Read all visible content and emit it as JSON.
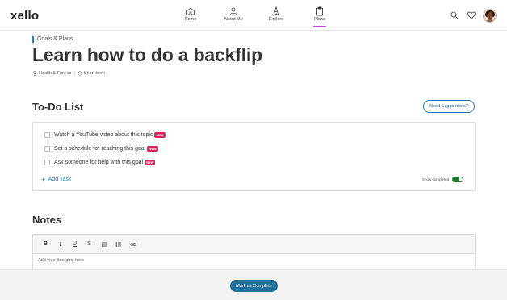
{
  "app": {
    "logo": "xello"
  },
  "nav": {
    "items": [
      {
        "label": "Home",
        "icon": "home-icon"
      },
      {
        "label": "About Me",
        "icon": "person-icon"
      },
      {
        "label": "Explore",
        "icon": "compass-icon"
      },
      {
        "label": "Plans",
        "icon": "clipboard-icon",
        "active": true
      }
    ],
    "accent_color": "#b24fc9"
  },
  "header_actions": {
    "search_icon": "search-icon",
    "favorites_icon": "heart-icon",
    "avatar": "user-avatar"
  },
  "breadcrumb": {
    "label": "Goals & Plans"
  },
  "page": {
    "title": "Learn how to do a backflip",
    "category": "Health & Fitness",
    "term": "Short-term"
  },
  "todo": {
    "title": "To-Do List",
    "suggestions_label": "Need Suggestions?",
    "tasks": [
      {
        "text": "Watch a YouTube video about this topic",
        "badge": "New"
      },
      {
        "text": "Set a schedule for reaching this goal",
        "badge": "New"
      },
      {
        "text": "Ask someone for help with this goal",
        "badge": "New"
      }
    ],
    "add_task_label": "Add Task",
    "show_completed_label": "Show completed",
    "show_completed_on": true
  },
  "notes": {
    "title": "Notes",
    "toolbar": [
      "bold",
      "italic",
      "underline",
      "strikethrough",
      "ordered-list",
      "bullet-list",
      "link"
    ],
    "placeholder": "Add your thoughts here"
  },
  "footer": {
    "complete_label": "Mark as Complete",
    "button_color": "#1f6f99"
  },
  "colors": {
    "link": "#1f7cb5",
    "badge": "#d9245a",
    "toggle": "#1e7d2d"
  }
}
